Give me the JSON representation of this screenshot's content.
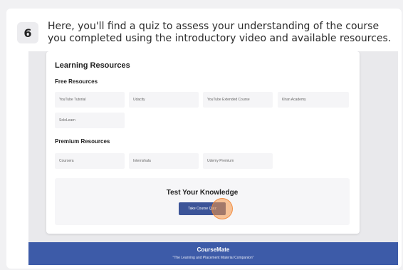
{
  "step": {
    "number": "6",
    "instruction": "Here, you'll find a quiz to assess your understanding of the course you completed using the introductory video and available resources."
  },
  "resources": {
    "title": "Learning Resources",
    "free_title": "Free Resources",
    "free": [
      "YouTube Tutorial",
      "Udacity",
      "YouTube Extended Course",
      "Khan Academy",
      "SoloLearn"
    ],
    "premium_title": "Premium Resources",
    "premium": [
      "Coursera",
      "Internshala",
      "Udemy Premium"
    ]
  },
  "quiz": {
    "title": "Test Your Knowledge",
    "button_label": "Take Course Quiz"
  },
  "footer": {
    "brand": "CourseMate",
    "tagline": "\"The Learning and Placement Material Companion\""
  },
  "colors": {
    "accent": "#3c5498",
    "footer": "#3d5ba8",
    "click_highlight": "#f59646"
  }
}
